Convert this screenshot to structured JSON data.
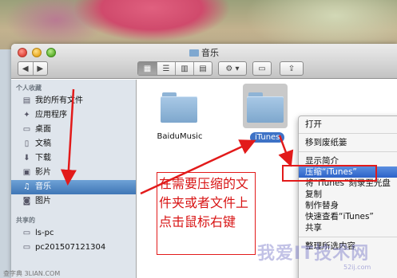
{
  "window": {
    "title": "音乐"
  },
  "toolbar": {
    "nav_back": "◀",
    "nav_forward": "▶",
    "view_modes": [
      "▦",
      "☰",
      "▥",
      "▤"
    ],
    "action_label": "⚙ ▾",
    "share_label": "⇪",
    "arrange_label": "▭"
  },
  "sidebar": {
    "favorites_header": "个人收藏",
    "items": [
      {
        "label": "我的所有文件",
        "icon": "all-files-icon",
        "glyph": "▤",
        "selected": false
      },
      {
        "label": "应用程序",
        "icon": "applications-icon",
        "glyph": "✦",
        "selected": false
      },
      {
        "label": "桌面",
        "icon": "desktop-icon",
        "glyph": "▭",
        "selected": false
      },
      {
        "label": "文稿",
        "icon": "documents-icon",
        "glyph": "▯",
        "selected": false
      },
      {
        "label": "下载",
        "icon": "downloads-icon",
        "glyph": "⬇",
        "selected": false
      },
      {
        "label": "影片",
        "icon": "movies-icon",
        "glyph": "▣",
        "selected": false
      },
      {
        "label": "音乐",
        "icon": "music-icon",
        "glyph": "♫",
        "selected": true
      },
      {
        "label": "图片",
        "icon": "pictures-icon",
        "glyph": "◙",
        "selected": false
      }
    ],
    "shared_header": "共享的",
    "shared": [
      {
        "label": "ls-pc",
        "icon": "computer-icon",
        "glyph": "▭"
      },
      {
        "label": "pc201507121304",
        "icon": "computer-icon",
        "glyph": "▭"
      }
    ]
  },
  "files": [
    {
      "name": "BaiduMusic"
    },
    {
      "name": "iTunes"
    }
  ],
  "context_menu": {
    "items": [
      "打开",
      "移到废纸篓",
      "显示简介",
      "压缩“iTunes”",
      "将“iTunes”刻录至光盘",
      "复制",
      "制作替身",
      "快速查看“iTunes”",
      "共享",
      "整理所选内容"
    ]
  },
  "annotation": {
    "text": "在需要压缩的文件夹或者文件上点击鼠标右键"
  },
  "watermark": {
    "text": "我爱IT技术网",
    "url": "52ij.com",
    "source": "查字典 3LIAN.COM"
  },
  "colors": {
    "selection": "#3d72c6",
    "highlight": "#2d62c8",
    "annotation": "#e21a1a"
  }
}
